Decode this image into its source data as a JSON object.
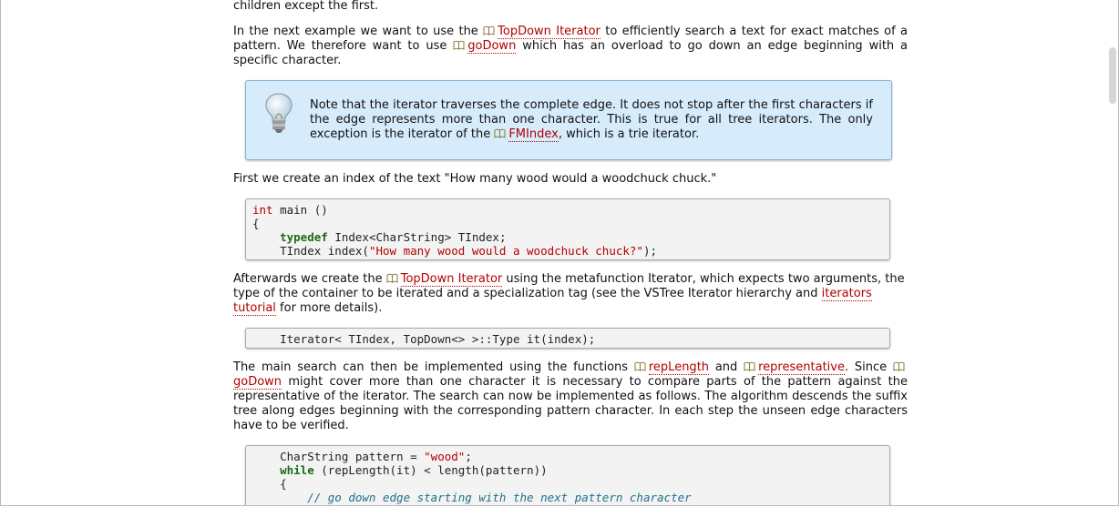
{
  "para0": {
    "text": "children except the first."
  },
  "para1": {
    "t1": "In the next example we want to use the ",
    "link1": "TopDown Iterator",
    "t2": " to efficiently search a text for exact matches of a pattern. We therefore want to use ",
    "link2": "goDown",
    "t3": " which has an overload to go down an edge beginning with a specific character."
  },
  "note": {
    "t1": "Note that the iterator traverses the complete edge. It does not stop after the first characters if the edge represents more than one character. This is true for all tree iterators. The only exception is the iterator of the ",
    "link": "FMIndex",
    "t2": ", which is a trie iterator."
  },
  "para2": {
    "text": "First we create an index of the text \"How many wood would a woodchuck chuck.\""
  },
  "code1": {
    "l1_kw": "int",
    "l1_rest": " main ()",
    "l2": "{",
    "l3_indent": "    ",
    "l3_kw": "typedef",
    "l3_rest": " Index<CharString> TIndex;",
    "l4_a": "    TIndex index(",
    "l4_str": "\"How many wood would a woodchuck chuck?\"",
    "l4_b": ");"
  },
  "para3": {
    "t1": "Afterwards we create the ",
    "link1": "TopDown Iterator",
    "t2": " using the metafunction Iterator, which expects two arguments, the type of the container to be iterated and a specialization tag (see the VSTree Iterator hierarchy and ",
    "link2": "iterators tutorial",
    "t3": " for more details)."
  },
  "code2": {
    "line": "    Iterator< TIndex, TopDown<> >::Type it(index);"
  },
  "para4": {
    "t1": "The main search can then be implemented using the functions ",
    "link1": "repLength",
    "t2": " and ",
    "link2": "representative",
    "t3": ". Since ",
    "link3": "goDown",
    "t4": " might cover more than one character it is necessary to compare parts of the pattern against the representative of the iterator. The search can now be implemented as follows. The algorithm descends the suffix tree along edges beginning with the corresponding pattern character. In each step the unseen edge characters have to be verified."
  },
  "code3": {
    "l1_a": "    CharString pattern = ",
    "l1_str": "\"wood\"",
    "l1_b": ";",
    "l2_indent": "    ",
    "l2_kw": "while",
    "l2_rest": " (repLength(it) < length(pattern))",
    "l3": "    {",
    "l4": "        // go down edge starting with the next pattern character"
  },
  "colors": {
    "link": "#b30000",
    "note_bg": "#d6ecfb",
    "code_bg": "#f3f3f3",
    "keyword_green": "#1a6b14"
  },
  "icons": {
    "book": "book-icon",
    "bulb": "lightbulb-icon"
  }
}
